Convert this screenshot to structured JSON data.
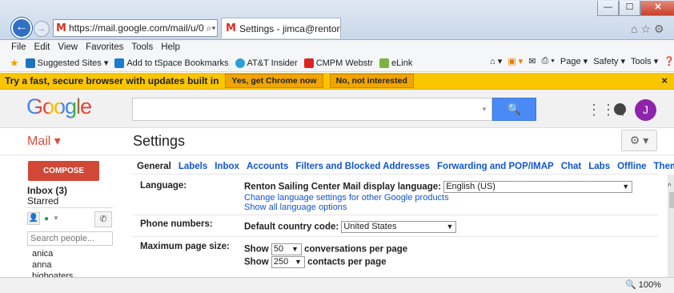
{
  "browser": {
    "address": "https://mail.google.com/mail/u/0",
    "tab_title": "Settings - jimca@rentonsail...",
    "gmail_favicon": "M",
    "tab_close": "×",
    "menu": [
      "File",
      "Edit",
      "View",
      "Favorites",
      "Tools",
      "Help"
    ],
    "favorites": [
      "Suggested Sites ▾",
      "Add to tSpace Bookmarks",
      "AT&T Insider",
      "CMPM Webstr",
      "eLink"
    ],
    "command_bar": [
      "Page ▾",
      "Safety ▾",
      "Tools ▾"
    ],
    "zoom": "100%"
  },
  "banner": {
    "text": "Try a fast, secure browser with updates built in",
    "yes_label": "Yes, get Chrome now",
    "no_label": "No, not interested",
    "close": "×"
  },
  "gmail": {
    "logo": "Google",
    "avatar_letter": "J",
    "mail_label": "Mail ▾",
    "page_title": "Settings",
    "compose_label": "COMPOSE",
    "inbox_label": "Inbox (3)",
    "starred_label": "Starred",
    "search_people_placeholder": "Search people...",
    "contacts": [
      "anica",
      "anna",
      "bigboaters"
    ]
  },
  "settings": {
    "tabs": [
      "General",
      "Labels",
      "Inbox",
      "Accounts",
      "Filters and Blocked Addresses",
      "Forwarding and POP/IMAP",
      "Chat",
      "Labs",
      "Offline",
      "Themes"
    ],
    "language": {
      "label": "Language:",
      "text": "Renton Sailing Center Mail display language:",
      "value": "English (US)",
      "link1": "Change language settings for other Google products",
      "link2": "Show all language options"
    },
    "phone": {
      "label": "Phone numbers:",
      "text": "Default country code:",
      "value": "United States"
    },
    "page_size": {
      "label": "Maximum page size:",
      "show1": "Show",
      "conv_value": "50",
      "conv_text": "conversations per page",
      "show2": "Show",
      "contacts_value": "250",
      "contacts_text": "contacts per page"
    }
  },
  "colors": {
    "banner_bg": "#f9c600",
    "compose_bg": "#d14836",
    "search_btn": "#4a8af4",
    "avatar_bg": "#8e24aa",
    "link": "#1155cc"
  }
}
